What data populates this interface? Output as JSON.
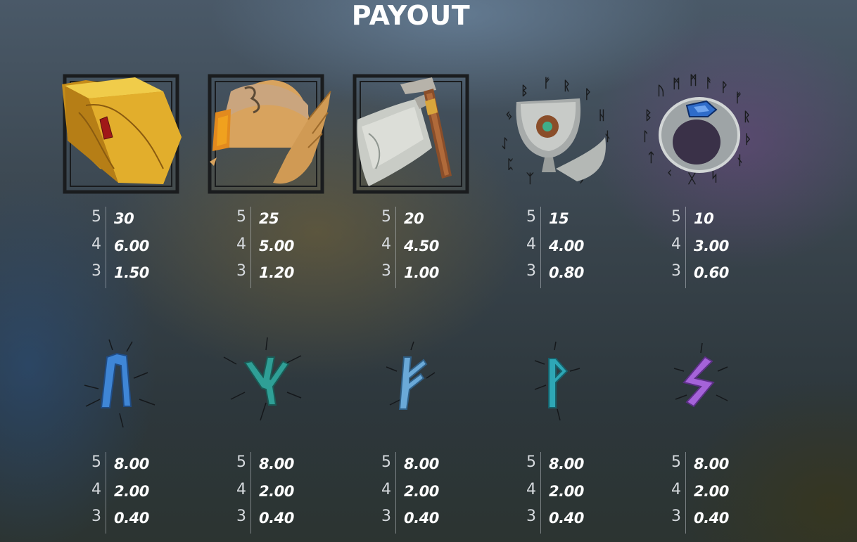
{
  "title": "PAYOUT",
  "symbols": [
    {
      "icon": "golden-book-icon",
      "payouts": [
        {
          "count": "5",
          "value": "30"
        },
        {
          "count": "4",
          "value": "6.00"
        },
        {
          "count": "3",
          "value": "1.50"
        }
      ]
    },
    {
      "icon": "winged-helmet-icon",
      "payouts": [
        {
          "count": "5",
          "value": "25"
        },
        {
          "count": "4",
          "value": "5.00"
        },
        {
          "count": "3",
          "value": "1.20"
        }
      ]
    },
    {
      "icon": "battle-axe-icon",
      "payouts": [
        {
          "count": "5",
          "value": "20"
        },
        {
          "count": "4",
          "value": "4.50"
        },
        {
          "count": "3",
          "value": "1.00"
        }
      ]
    },
    {
      "icon": "chalice-icon",
      "payouts": [
        {
          "count": "5",
          "value": "15"
        },
        {
          "count": "4",
          "value": "4.00"
        },
        {
          "count": "3",
          "value": "0.80"
        }
      ]
    },
    {
      "icon": "sapphire-ring-icon",
      "payouts": [
        {
          "count": "5",
          "value": "10"
        },
        {
          "count": "4",
          "value": "3.00"
        },
        {
          "count": "3",
          "value": "0.60"
        }
      ]
    },
    {
      "icon": "blue-rune-uruz-icon",
      "color": "#3f86d6",
      "payouts": [
        {
          "count": "5",
          "value": "8.00"
        },
        {
          "count": "4",
          "value": "2.00"
        },
        {
          "count": "3",
          "value": "0.40"
        }
      ]
    },
    {
      "icon": "teal-rune-algiz-icon",
      "color": "#2f9f96",
      "payouts": [
        {
          "count": "5",
          "value": "8.00"
        },
        {
          "count": "4",
          "value": "2.00"
        },
        {
          "count": "3",
          "value": "0.40"
        }
      ]
    },
    {
      "icon": "lightblue-rune-fehu-icon",
      "color": "#6aa9d8",
      "payouts": [
        {
          "count": "5",
          "value": "8.00"
        },
        {
          "count": "4",
          "value": "2.00"
        },
        {
          "count": "3",
          "value": "0.40"
        }
      ]
    },
    {
      "icon": "cyan-rune-wunjo-icon",
      "color": "#2ea7b6",
      "payouts": [
        {
          "count": "5",
          "value": "8.00"
        },
        {
          "count": "4",
          "value": "2.00"
        },
        {
          "count": "3",
          "value": "0.40"
        }
      ]
    },
    {
      "icon": "purple-rune-sowilo-icon",
      "color": "#a563d9",
      "payouts": [
        {
          "count": "5",
          "value": "8.00"
        },
        {
          "count": "4",
          "value": "2.00"
        },
        {
          "count": "3",
          "value": "0.40"
        }
      ]
    }
  ]
}
